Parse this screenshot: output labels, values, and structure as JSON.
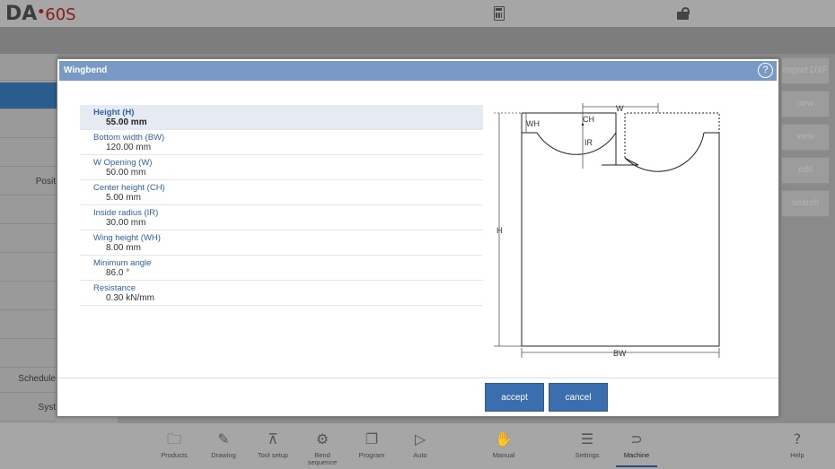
{
  "header": {
    "logo_brand": "DA",
    "logo_dot": "•",
    "logo_model": "60S",
    "calculator_icon": "calculator-icon",
    "lock_icon": "unlock-icon"
  },
  "sidebar": {
    "items": [
      {
        "label": ""
      },
      {
        "label": ""
      },
      {
        "label": ""
      },
      {
        "label": ""
      },
      {
        "label": "Posit"
      },
      {
        "label": ""
      },
      {
        "label": ""
      },
      {
        "label": ""
      },
      {
        "label": ""
      },
      {
        "label": ""
      },
      {
        "label": ""
      },
      {
        "label": "Schedule"
      },
      {
        "label": "Syst"
      }
    ]
  },
  "right_buttons": [
    {
      "label": "import DXF"
    },
    {
      "label": "new"
    },
    {
      "label": "view"
    },
    {
      "label": "edit"
    },
    {
      "label": "search"
    }
  ],
  "modal": {
    "title": "Wingbend",
    "help_icon": "?",
    "params": [
      {
        "label": "Height (H)",
        "value": "55.00 mm"
      },
      {
        "label": "Bottom width (BW)",
        "value": "120.00 mm"
      },
      {
        "label": "W Opening (W)",
        "value": "50.00 mm"
      },
      {
        "label": "Center height (CH)",
        "value": "5.00 mm"
      },
      {
        "label": "Inside radius (IR)",
        "value": "30.00 mm"
      },
      {
        "label": "Wing height (WH)",
        "value": "8.00 mm"
      },
      {
        "label": "Minimum angle",
        "value": "86.0 °"
      },
      {
        "label": "Resistance",
        "value": "0.30 kN/mm"
      }
    ],
    "diagram_labels": {
      "w": "W",
      "wh": "WH",
      "ch": "CH",
      "ir": "IR",
      "h": "H",
      "bw": "BW"
    },
    "accept_label": "accept",
    "cancel_label": "cancel"
  },
  "bottom_nav": [
    {
      "label": "Products",
      "icon": "folder-icon"
    },
    {
      "label": "Drawing",
      "icon": "pencil-icon"
    },
    {
      "label": "Tool setup",
      "icon": "tool-icon"
    },
    {
      "label": "Bend\nsequence",
      "icon": "bend-sequence-icon"
    },
    {
      "label": "Program",
      "icon": "program-icon"
    },
    {
      "label": "Auto",
      "icon": "play-icon"
    },
    {
      "label": "Manual",
      "icon": "hand-icon"
    },
    {
      "label": "Settings",
      "icon": "settings-list-icon"
    },
    {
      "label": "Machine",
      "icon": "machine-icon"
    },
    {
      "label": "Help",
      "icon": "help-icon"
    }
  ]
}
